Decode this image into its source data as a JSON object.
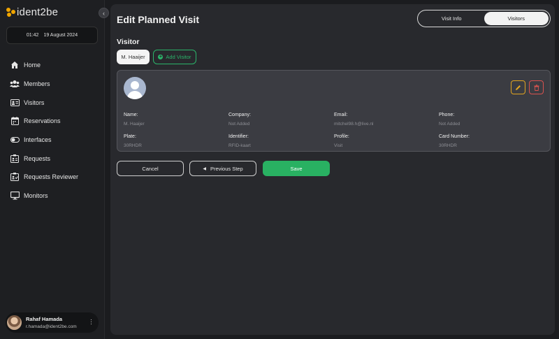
{
  "sidebar": {
    "logo_text": "ident2be",
    "collapse_icon": "chevron-left-icon",
    "time": "01:42",
    "date": "19 August 2024",
    "items": [
      {
        "label": "Home",
        "icon": "home-icon"
      },
      {
        "label": "Members",
        "icon": "members-icon"
      },
      {
        "label": "Visitors",
        "icon": "id-card-icon"
      },
      {
        "label": "Reservations",
        "icon": "calendar-icon"
      },
      {
        "label": "Interfaces",
        "icon": "toggle-icon"
      },
      {
        "label": "Requests",
        "icon": "request-icon"
      },
      {
        "label": "Requests Reviewer",
        "icon": "request-reviewer-icon"
      },
      {
        "label": "Monitors",
        "icon": "monitor-icon"
      }
    ],
    "user": {
      "name": "Rahaf Hamada",
      "email": "r.hamada@ident2be.com"
    }
  },
  "main": {
    "title": "Edit Planned Visit",
    "tabs": [
      {
        "label": "Visit Info",
        "active": false
      },
      {
        "label": "Visitors",
        "active": true
      }
    ],
    "section_title": "Visitor",
    "visitor_chip": "M. Haaijer",
    "add_visitor_label": "Add Visitor",
    "card": {
      "fields": [
        {
          "label": "Name:",
          "value": "M. Haaijer"
        },
        {
          "label": "Company:",
          "value": "Not Added"
        },
        {
          "label": "Email:",
          "value": "mitchel98.h@live.nl"
        },
        {
          "label": "Phone:",
          "value": "Not Added"
        },
        {
          "label": "Plate:",
          "value": "30RHDR"
        },
        {
          "label": "Identifier:",
          "value": "RFID-kaart"
        },
        {
          "label": "Profile:",
          "value": "Visit"
        },
        {
          "label": "Card Number:",
          "value": "30RHDR"
        }
      ]
    },
    "buttons": {
      "cancel": "Cancel",
      "previous": "Previous Step",
      "save": "Save"
    }
  },
  "colors": {
    "accent_green": "#29b162",
    "edit_orange": "#e2a520",
    "delete_red": "#d9534f",
    "logo_yellow": "#f0a500"
  }
}
